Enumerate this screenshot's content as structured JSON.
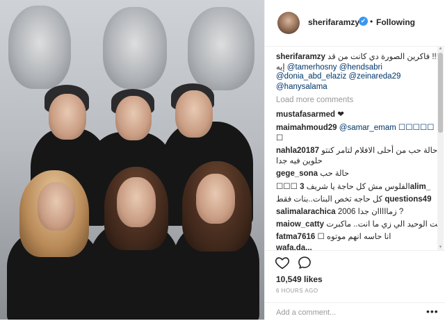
{
  "header": {
    "username": "sherifaramzy",
    "verified_glyph": "✔",
    "separator": "•",
    "follow_status": "Following"
  },
  "caption": {
    "username": "sherifaramzy",
    "line1": "يا!!!!!!!!!! فاكرين الصورة دي كانت من قد",
    "line2_text": "إيه",
    "line2_mention": "@tamerhosny @hendsabri",
    "line3_mention": "@donia_abd_elaziz @zeinareda29",
    "line4_mention": "@hanysalama"
  },
  "load_more": "Load more comments",
  "comments": [
    {
      "user": "mustafasarmed",
      "text": "❤",
      "cont": ""
    },
    {
      "user": "maimahmoud29",
      "text": "@samar_emam ☐☐☐☐☐",
      "cont": "☐"
    },
    {
      "user": "nahla20187",
      "text": "حالة حب من أحلى الافلام لتامر كنتو",
      "cont": "حلوين فيه جدا"
    },
    {
      "user": "gege_sona",
      "text": "حالة حب",
      "cont": ""
    },
    {
      "user": "3alim_",
      "text": "☐☐☐ الفلوس مش كل حاجة يا شريف",
      "cont": ""
    },
    {
      "user": "questions49",
      "text": "كل حاجه تخص البنات..بنات فقط",
      "cont": ""
    },
    {
      "user": "salimalarachica",
      "text": "زمااااان جدا 2006 ?",
      "cont": ""
    },
    {
      "user": "maiow_catty",
      "text": "انت الوحيد الي زي ما انت.. ماكبرت",
      "cont": ""
    },
    {
      "user": "fatma7616",
      "text": "☐ انا حاسه انهم موتوه",
      "cont": ""
    },
    {
      "user": "wafa.da...",
      "text": "",
      "cont": ""
    }
  ],
  "actions": {
    "like_icon": "heart-icon",
    "comment_icon": "comment-icon",
    "likes": "10,549 likes",
    "time": "6 HOURS AGO",
    "add_comment_placeholder": "Add a comment...",
    "more_glyph": "•••"
  },
  "scrollbar": {
    "up": "▲",
    "down": "▼"
  }
}
